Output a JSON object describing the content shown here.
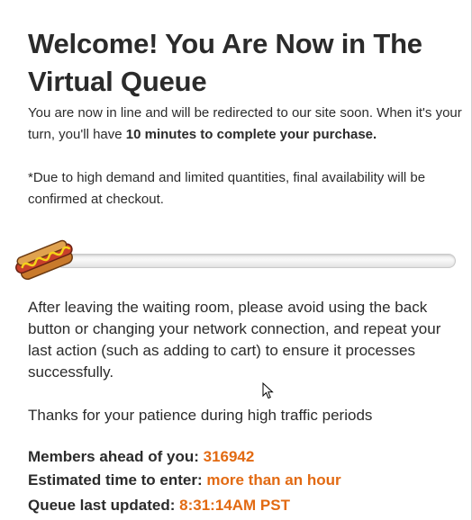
{
  "header": {
    "title": "Welcome! You Are Now in The Virtual Queue"
  },
  "intro": {
    "text_before": "You are now in line and will be redirected to our site soon. When it's your turn, you'll have ",
    "bold_text": "10 minutes to complete your purchase.",
    "note": "*Due to high demand and limited quantities, final availability will be confirmed at checkout."
  },
  "progress": {
    "icon": "hotdog-icon",
    "fraction": 0.0
  },
  "instructions": "After leaving the waiting room, please avoid using the back button or changing your network connection, and repeat your last action (such as adding to cart) to ensure it processes successfully.",
  "thanks": "Thanks for your patience during high traffic periods",
  "stats": {
    "members_label": "Members ahead of you:",
    "members_value": "316942",
    "eta_label": "Estimated time to enter:",
    "eta_value": "more than an hour",
    "updated_label": "Queue last updated:",
    "updated_value": "8:31:14AM PST"
  },
  "colors": {
    "accent": "#e26a12",
    "text": "#2b2b2b"
  }
}
